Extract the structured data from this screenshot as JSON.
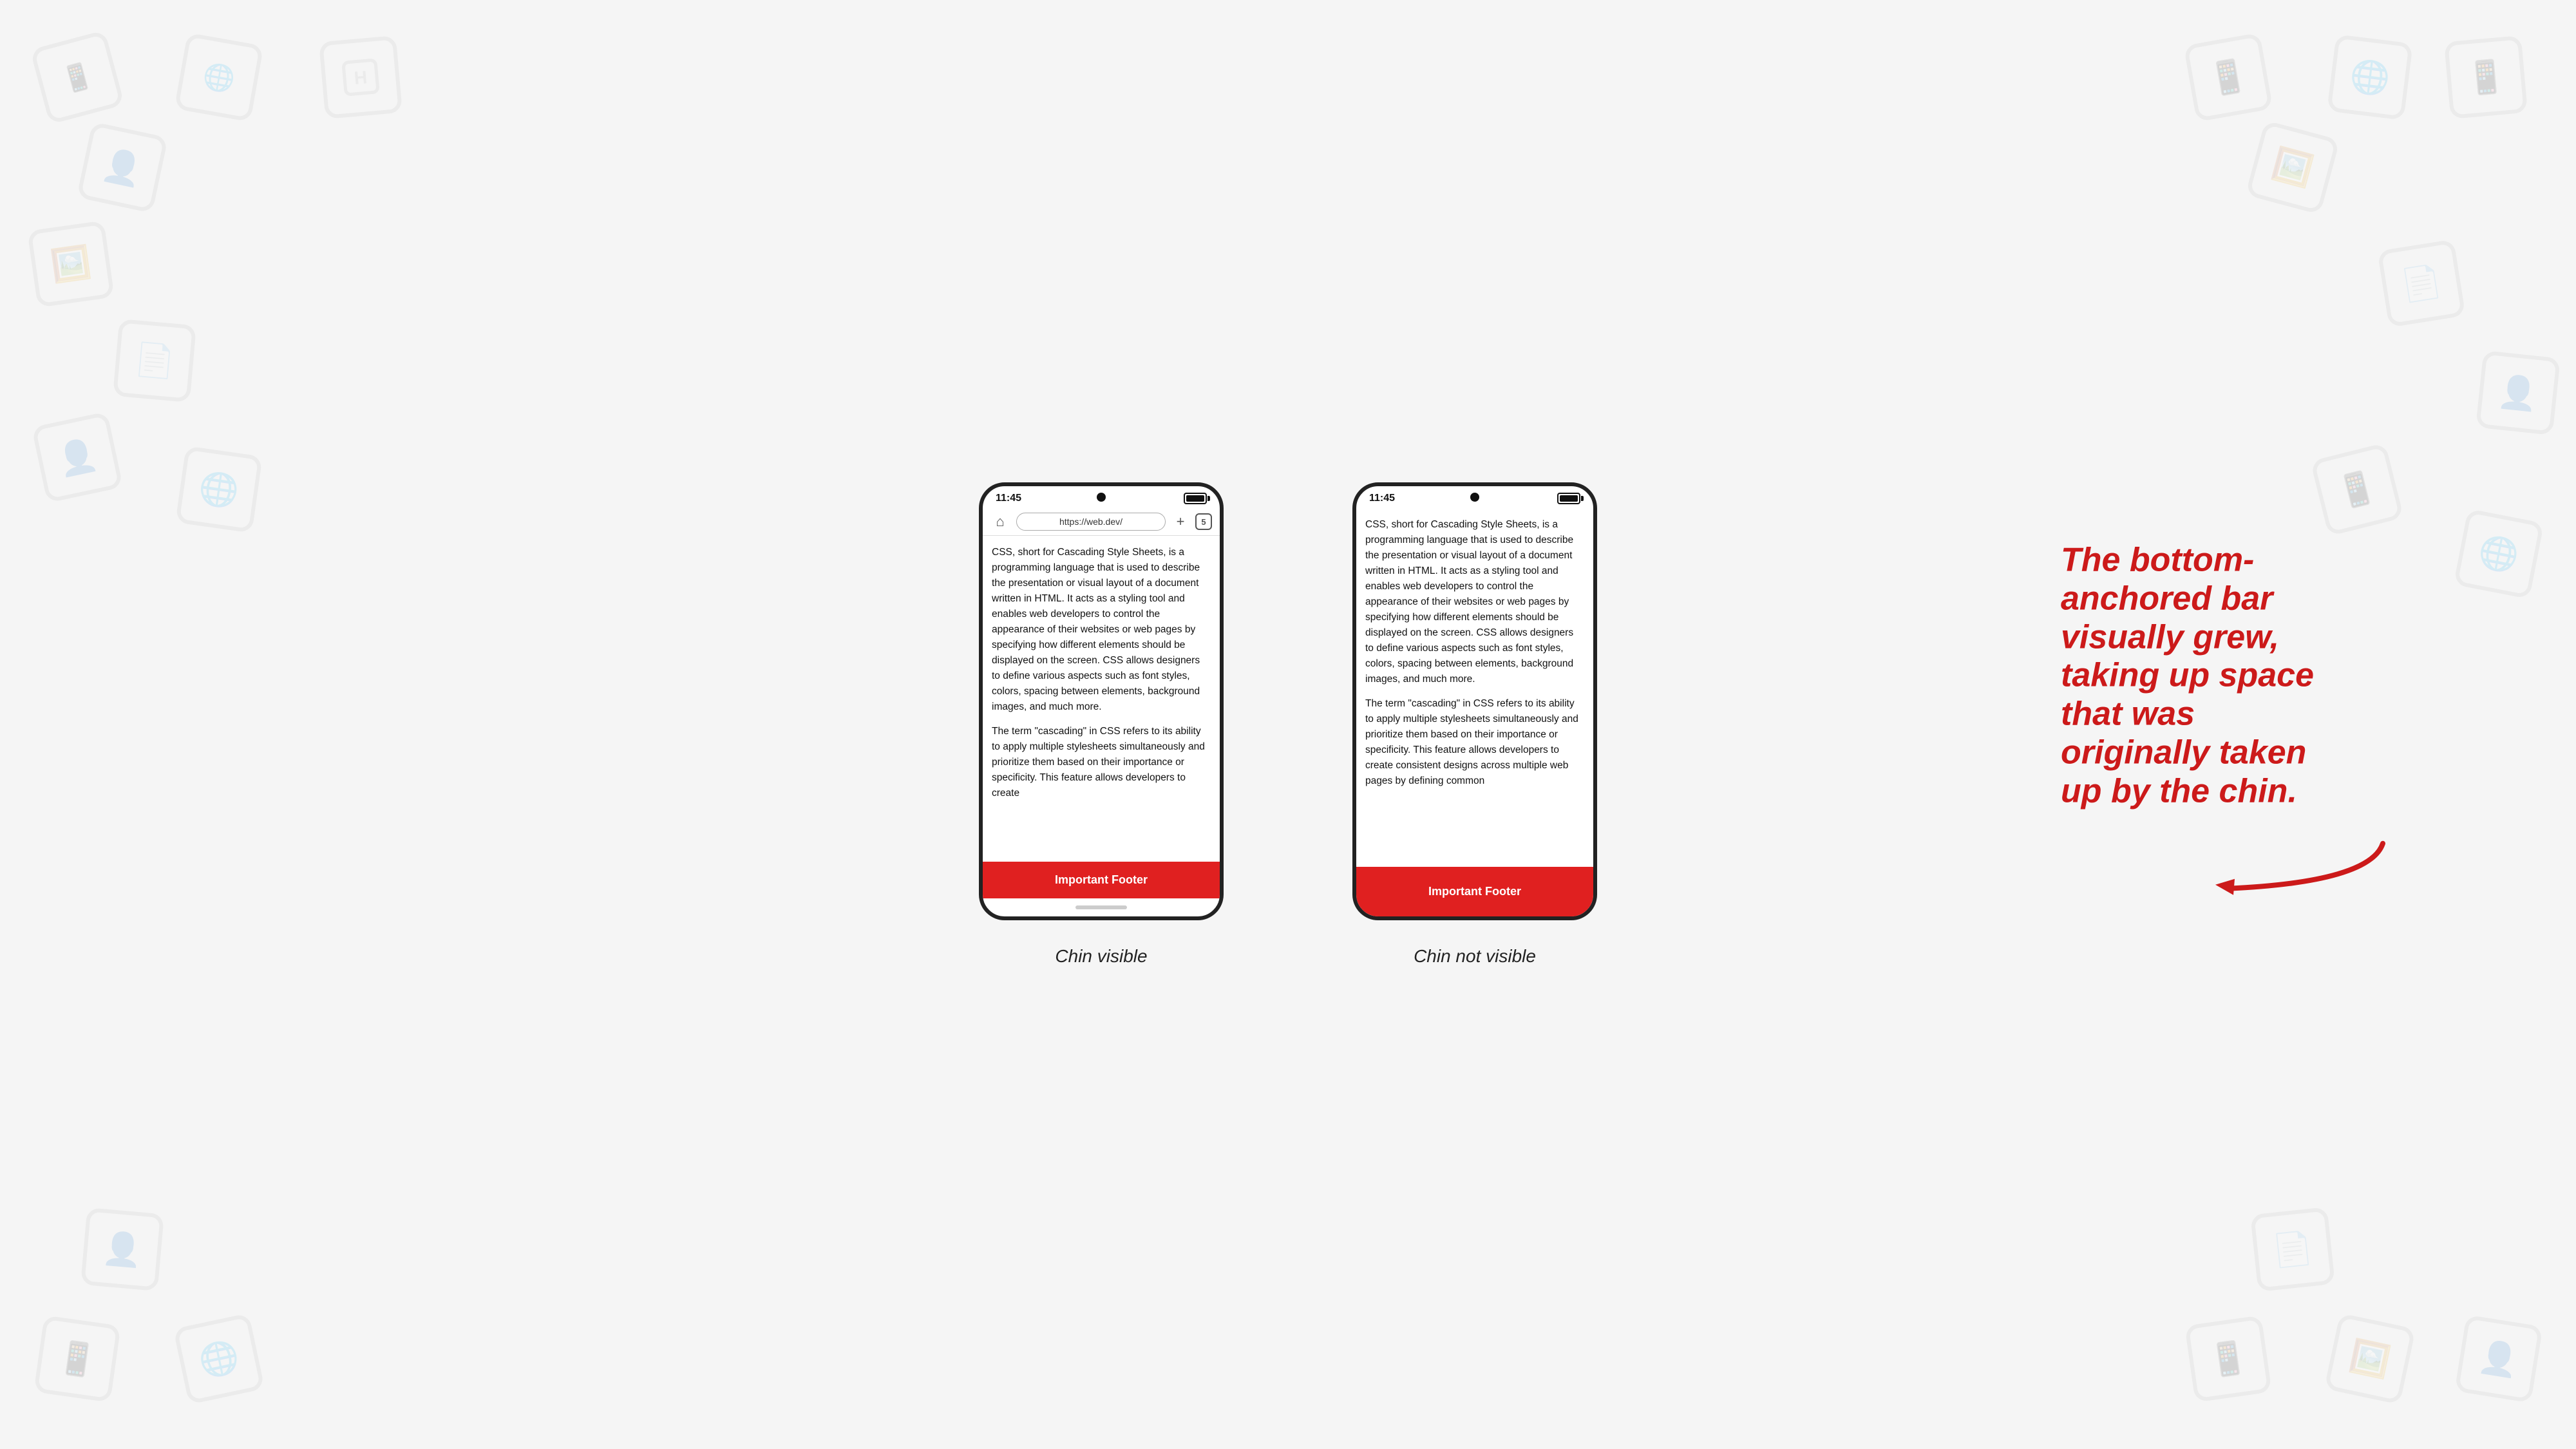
{
  "background": {
    "color": "#f5f5f5"
  },
  "phone_left": {
    "status_time": "11:45",
    "url": "https://web.dev/",
    "tab_count": "5",
    "content_paragraphs": [
      "CSS, short for Cascading Style Sheets, is a programming language that is used to describe the presentation or visual layout of a document written in HTML. It acts as a styling tool and enables web developers to control the appearance of their websites or web pages by specifying how different elements should be displayed on the screen. CSS allows designers to define various aspects such as font styles, colors, spacing between elements, background images, and much more.",
      "The term \"cascading\" in CSS refers to its ability to apply multiple stylesheets simultaneously and prioritize them based on their importance or specificity. This feature allows developers to create"
    ],
    "footer_text": "Important Footer",
    "caption": "Chin visible",
    "has_chin": true
  },
  "phone_right": {
    "status_time": "11:45",
    "content_paragraphs": [
      "CSS, short for Cascading Style Sheets, is a programming language that is used to describe the presentation or visual layout of a document written in HTML. It acts as a styling tool and enables web developers to control the appearance of their websites or web pages by specifying how different elements should be displayed on the screen. CSS allows designers to define various aspects such as font styles, colors, spacing between elements, background images, and much more.",
      "The term \"cascading\" in CSS refers to its ability to apply multiple stylesheets simultaneously and prioritize them based on their importance or specificity. This feature allows developers to create consistent designs across multiple web pages by defining common"
    ],
    "footer_text": "Important Footer",
    "caption": "Chin not visible",
    "has_chin": false
  },
  "annotation": {
    "line1": "The bottom-",
    "line2": "anchored bar",
    "line3": "visually grew,",
    "line4": "taking up space",
    "line5": "that was",
    "line6": "originally taken",
    "line7": "up by the chin.",
    "full_text": "The bottom-anchored bar visually grew, taking up space that was originally taken up by the chin."
  }
}
